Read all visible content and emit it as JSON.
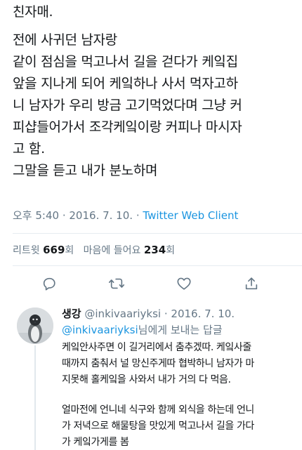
{
  "tweet": {
    "lines_block1": [
      "친자매."
    ],
    "lines_block2": [
      "전에 사귀던 남자랑",
      "같이 점심을 먹고나서 길을 걷다가  케잌집",
      "앞을 지나게 되어 케잌하나 사서 먹자고하",
      "니 남자가 우리 방금 고기먹었다며 그냥 커",
      "피샵들어가서 조각케잌이랑 커피나 마시자",
      "고 함.",
      "그말을 듣고 내가 분노하며"
    ],
    "time": "오후 5:40",
    "date": "2016. 7. 10.",
    "separator": "·",
    "client": "Twitter Web Client"
  },
  "stats": {
    "retweets_label": "리트윗",
    "retweets_count": "669",
    "retweets_unit": "회",
    "likes_label": "마음에 들어요",
    "likes_count": "234",
    "likes_unit": "회"
  },
  "actions": {
    "reply_icon": "reply-icon",
    "retweet_icon": "retweet-icon",
    "like_icon": "heart-icon",
    "share_icon": "share-icon",
    "color": "#657786"
  },
  "reply": {
    "name": "생강",
    "handle": "@inkivaariyksi",
    "dot": "·",
    "date": "2016. 7. 10.",
    "reply_to_mention": "@inkivaariyksi",
    "reply_to_suffix": "님에게 보내는 답글",
    "lines_block1": [
      "케잌안사주면 이 길거리에서 춤추겠따. 케잌사줄",
      "때까지 춤춰서 널 망신주게따 협박하니 남자가 마",
      "지못해 홀케잌을 사와서 내가 거의 다 먹음."
    ],
    "lines_block2": [
      "얼마전에 언니네 식구와 함께 외식을 하는데 언니",
      "가 저녁으로 해물탕을 맛있게 먹고나서 길을 가다",
      "가 케잌가게를 봄"
    ]
  },
  "colors": {
    "text": "#14171a",
    "muted": "#657786",
    "link": "#1b95e0",
    "divider": "#e6ecf0"
  }
}
